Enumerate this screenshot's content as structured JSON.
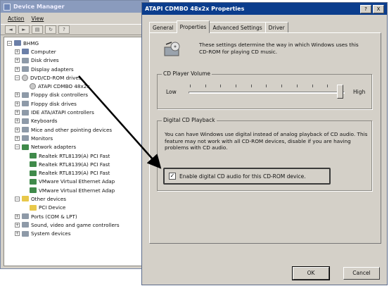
{
  "device_manager": {
    "title": "Device Manager",
    "menus": [
      "Action",
      "View"
    ],
    "toolbar_icons": [
      "back-arrow-icon",
      "forward-arrow-icon",
      "properties-icon",
      "refresh-icon",
      "help-icon"
    ],
    "tree": [
      {
        "label": "BHMG",
        "expander": "−",
        "icon": "computer-icon",
        "indent": 0
      },
      {
        "label": "Computer",
        "expander": "+",
        "icon": "computer-icon",
        "indent": 1
      },
      {
        "label": "Disk drives",
        "expander": "+",
        "icon": "disk-icon",
        "indent": 1
      },
      {
        "label": "Display adapters",
        "expander": "+",
        "icon": "display-icon",
        "indent": 1
      },
      {
        "label": "DVD/CD-ROM drives",
        "expander": "−",
        "icon": "cdrom-icon",
        "indent": 1
      },
      {
        "label": "ATAPI CDMBO 48x2x",
        "expander": "",
        "icon": "cdrom-icon",
        "indent": 2
      },
      {
        "label": "Floppy disk controllers",
        "expander": "+",
        "icon": "controller-icon",
        "indent": 1
      },
      {
        "label": "Floppy disk drives",
        "expander": "+",
        "icon": "floppy-icon",
        "indent": 1
      },
      {
        "label": "IDE ATA/ATAPI controllers",
        "expander": "+",
        "icon": "controller-icon",
        "indent": 1
      },
      {
        "label": "Keyboards",
        "expander": "+",
        "icon": "keyboard-icon",
        "indent": 1
      },
      {
        "label": "Mice and other pointing devices",
        "expander": "+",
        "icon": "mouse-icon",
        "indent": 1
      },
      {
        "label": "Monitors",
        "expander": "+",
        "icon": "monitor-icon",
        "indent": 1
      },
      {
        "label": "Network adapters",
        "expander": "−",
        "icon": "network-icon",
        "indent": 1
      },
      {
        "label": "Realtek RTL8139(A) PCI Fast",
        "expander": "",
        "icon": "network-icon",
        "indent": 2
      },
      {
        "label": "Realtek RTL8139(A) PCI Fast",
        "expander": "",
        "icon": "network-icon",
        "indent": 2
      },
      {
        "label": "Realtek RTL8139(A) PCI Fast",
        "expander": "",
        "icon": "network-icon",
        "indent": 2
      },
      {
        "label": "VMware Virtual Ethernet Adap",
        "expander": "",
        "icon": "network-icon",
        "indent": 2
      },
      {
        "label": "VMware Virtual Ethernet Adap",
        "expander": "",
        "icon": "network-icon",
        "indent": 2
      },
      {
        "label": "Other devices",
        "expander": "−",
        "icon": "unknown-device-icon",
        "indent": 1
      },
      {
        "label": "PCI Device",
        "expander": "",
        "icon": "unknown-device-icon",
        "indent": 2
      },
      {
        "label": "Ports (COM & LPT)",
        "expander": "+",
        "icon": "port-icon",
        "indent": 1
      },
      {
        "label": "Sound, video and game controllers",
        "expander": "+",
        "icon": "sound-icon",
        "indent": 1
      },
      {
        "label": "System devices",
        "expander": "+",
        "icon": "system-icon",
        "indent": 1
      }
    ]
  },
  "properties_dialog": {
    "title": "ATAPI CDMBO 48x2x Properties",
    "help_button": "?",
    "close_button": "X",
    "tabs": [
      "General",
      "Properties",
      "Advanced Settings",
      "Driver"
    ],
    "active_tab": "Properties",
    "intro_text": "These settings determine the way in which Windows uses this CD-ROM for playing CD music.",
    "volume_group": {
      "label": "CD Player Volume",
      "low": "Low",
      "high": "High",
      "level": 0.97
    },
    "digital_group": {
      "label": "Digital CD Playback",
      "description": "You can have Windows use digital instead of analog playback of CD audio. This feature may not work with all CD-ROM devices, disable if you are having problems with CD audio.",
      "checkbox_label": "Enable digital CD audio for this CD-ROM device.",
      "checkbox_checked": true
    },
    "ok_label": "OK",
    "cancel_label": "Cancel"
  }
}
